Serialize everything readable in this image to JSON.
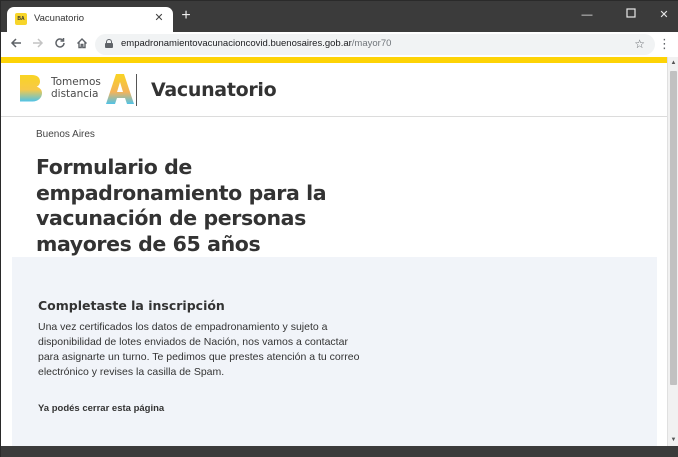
{
  "browser": {
    "tab_title": "Vacunatorio",
    "favicon_text": "BA",
    "url_domain": "empadronamientovacunacioncovid.buenosaires.gob.ar",
    "url_path": "/mayor70",
    "icons": {
      "tab_close": "close-icon",
      "new_tab": "plus-icon",
      "minimize": "minimize-icon",
      "maximize": "maximize-icon",
      "close": "close-icon",
      "back": "arrow-left-icon",
      "forward": "arrow-right-icon",
      "reload": "reload-icon",
      "home": "home-icon",
      "lock": "lock-icon",
      "bookmark": "star-icon",
      "menu": "more-vert-icon"
    }
  },
  "header": {
    "logo_line1": "Tomemos",
    "logo_line2": "distancia",
    "site_name": "Vacunatorio",
    "accent_color": "#fdd306"
  },
  "main": {
    "breadcrumb": "Buenos Aires",
    "title_lines": [
      "Formulario de",
      "empadronamiento para la",
      "vacunación de personas",
      "mayores de 65 años"
    ]
  },
  "result": {
    "heading": "Completaste la inscripción",
    "body_lines": [
      "Una vez certificados los datos de empadronamiento y sujeto a",
      "disponibilidad de lotes enviados de Nación, nos vamos a contactar",
      "para asignarte un turno. Te pedimos que prestes atención a tu correo",
      "electrónico y revises la casilla de Spam."
    ],
    "note": "Ya podés cerrar esta página",
    "panel_color": "#f1f4f9"
  }
}
